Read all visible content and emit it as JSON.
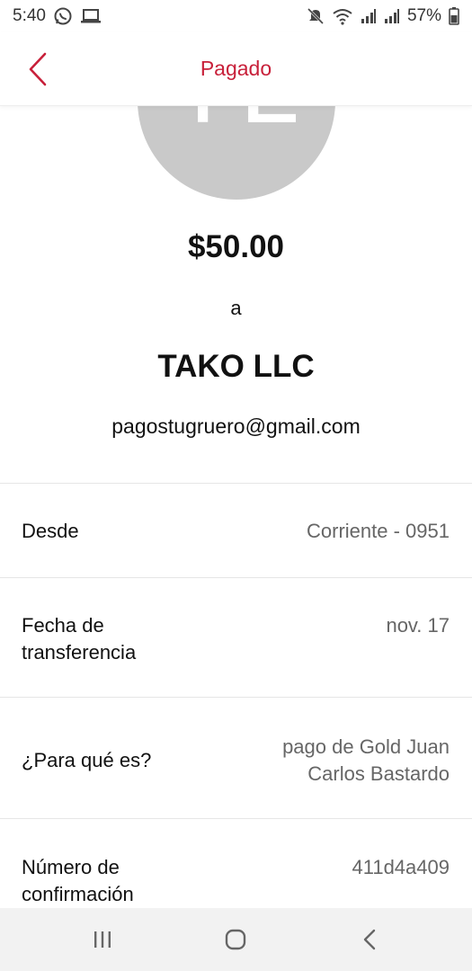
{
  "status_bar": {
    "time": "5:40",
    "battery": "57%",
    "icons": [
      "whatsapp-icon",
      "laptop-icon",
      "mute-icon",
      "wifi-icon",
      "signal-icon",
      "signal-icon",
      "battery-icon"
    ]
  },
  "header": {
    "title": "Pagado",
    "back_icon": "chevron-left-icon",
    "accent_color": "#c8203a"
  },
  "payment": {
    "avatar_initials": "TL",
    "amount": "$50.00",
    "preposition": "a",
    "recipient_name": "TAKO LLC",
    "recipient_email": "pagostugruero@gmail.com"
  },
  "details": {
    "from": {
      "label": "Desde",
      "value": "Corriente - 0951"
    },
    "date": {
      "label_line1": "Fecha de",
      "label_line2": "transferencia",
      "value": "nov. 17"
    },
    "memo": {
      "label": "¿Para qué es?",
      "value_line1": "pago de Gold Juan",
      "value_line2": "Carlos Bastardo"
    },
    "confirmation": {
      "label_line1": "Número de",
      "label_line2": "confirmación",
      "value": "411d4a409"
    }
  },
  "nav_bar": {
    "icons": [
      "recent-apps-icon",
      "home-icon",
      "back-icon"
    ]
  }
}
